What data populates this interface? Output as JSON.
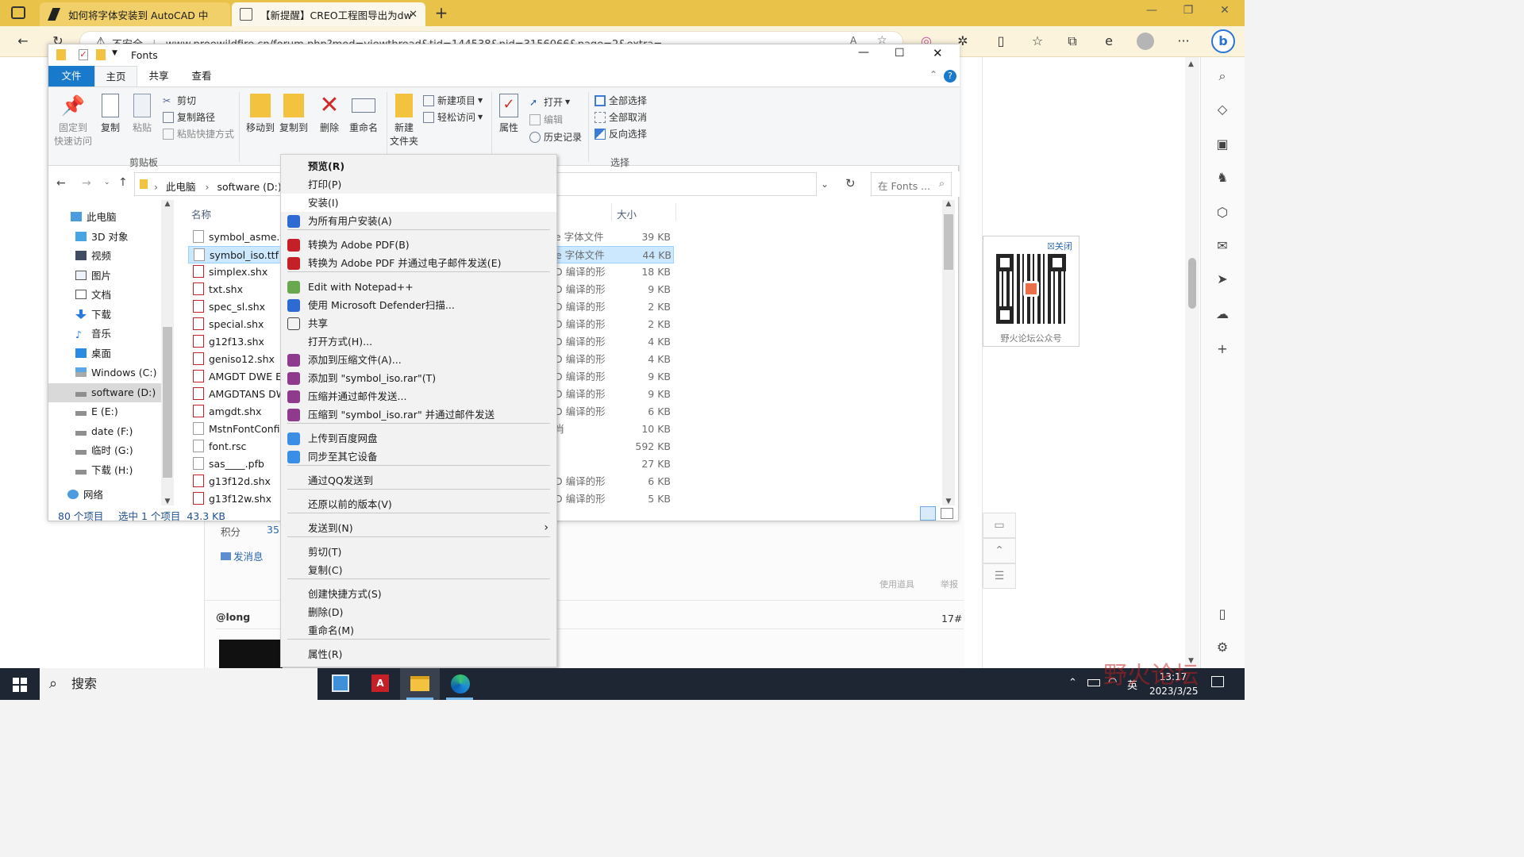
{
  "browser": {
    "tabs": [
      {
        "label": "如何将字体安装到 AutoCAD 中"
      },
      {
        "label": "【新提醒】CREO工程图导出为dwg"
      }
    ],
    "address": {
      "security": "不安全",
      "url": "www.proewildfire.cn/forum.php?mod=viewthread&tid=144538&pid=3156066&page=2&extra="
    }
  },
  "explorer": {
    "title": "Fonts",
    "ribbon_tabs": [
      "文件",
      "主页",
      "共享",
      "查看"
    ],
    "clipboard": {
      "pin": "固定到",
      "pin2": "快速访问",
      "copy": "复制",
      "paste": "粘贴",
      "cut": "剪切",
      "copy_path": "复制路径",
      "paste_shortcut": "粘贴快捷方式",
      "group": "剪贴板"
    },
    "organize": {
      "move_to": "移动到",
      "copy_to": "复制到",
      "delete": "删除",
      "rename": "重命名"
    },
    "new": {
      "new_folder": "新建",
      "new_folder2": "文件夹",
      "new_item": "新建项目",
      "easy_access": "轻松访问"
    },
    "open": {
      "properties": "属性",
      "open": "打开",
      "edit": "编辑",
      "history": "历史记录"
    },
    "select": {
      "select_all": "全部选择",
      "select_none": "全部取消",
      "invert": "反向选择",
      "group": "选择"
    },
    "breadcrumb": [
      "此电脑",
      "software (D:)"
    ],
    "search_placeholder": "在 Fonts ...",
    "nav": [
      {
        "label": "此电脑"
      },
      {
        "label": "3D 对象"
      },
      {
        "label": "视频"
      },
      {
        "label": "图片"
      },
      {
        "label": "文档"
      },
      {
        "label": "下载"
      },
      {
        "label": "音乐"
      },
      {
        "label": "桌面"
      },
      {
        "label": "Windows (C:)"
      },
      {
        "label": "software (D:)"
      },
      {
        "label": "E (E:)"
      },
      {
        "label": "date (F:)"
      },
      {
        "label": "临时 (G:)"
      },
      {
        "label": "下载 (H:)"
      },
      {
        "label": "网络"
      }
    ],
    "columns": {
      "name": "名称",
      "size": "大小"
    },
    "files": [
      {
        "name": "symbol_asme.ttf",
        "type": "e 字体文件",
        "size": "39 KB"
      },
      {
        "name": "symbol_iso.ttf",
        "type": "e 字体文件",
        "size": "44 KB"
      },
      {
        "name": "simplex.shx",
        "type": "D 编译的形",
        "size": "18 KB"
      },
      {
        "name": "txt.shx",
        "type": "D 编译的形",
        "size": "9 KB"
      },
      {
        "name": "spec_sl.shx",
        "type": "D 编译的形",
        "size": "2 KB"
      },
      {
        "name": "special.shx",
        "type": "D 编译的形",
        "size": "2 KB"
      },
      {
        "name": "g12f13.shx",
        "type": "D 编译的形",
        "size": "4 KB"
      },
      {
        "name": "geniso12.shx",
        "type": "D 编译的形",
        "size": "4 KB"
      },
      {
        "name": "AMGDT DWE Ec",
        "type": "D 编译的形",
        "size": "9 KB"
      },
      {
        "name": "AMGDTANS DW",
        "type": "D 编译的形",
        "size": "9 KB"
      },
      {
        "name": "amgdt.shx",
        "type": "D 编译的形",
        "size": "6 KB"
      },
      {
        "name": "MstnFontConfi",
        "type": "肖",
        "size": "10 KB"
      },
      {
        "name": "font.rsc",
        "type": "",
        "size": "592 KB"
      },
      {
        "name": "sas____.pfb",
        "type": "",
        "size": "27 KB"
      },
      {
        "name": "g13f12d.shx",
        "type": "D 编译的形",
        "size": "6 KB"
      },
      {
        "name": "g13f12w.shx",
        "type": "D 编译的形",
        "size": "5 KB"
      }
    ],
    "status": {
      "count": "80 个项目",
      "selected": "选中 1 个项目  43.3 KB"
    }
  },
  "context_menu": [
    {
      "label": "预览(R)"
    },
    {
      "label": "打印(P)"
    },
    {
      "label": "安装(I)"
    },
    {
      "label": "为所有用户安装(A)"
    },
    {
      "label": "转换为 Adobe PDF(B)"
    },
    {
      "label": "转换为 Adobe PDF 并通过电子邮件发送(E)"
    },
    {
      "label": "Edit with Notepad++"
    },
    {
      "label": "使用 Microsoft Defender扫描..."
    },
    {
      "label": "共享"
    },
    {
      "label": "打开方式(H)..."
    },
    {
      "label": "添加到压缩文件(A)..."
    },
    {
      "label": "添加到 \"symbol_iso.rar\"(T)"
    },
    {
      "label": "压缩并通过邮件发送..."
    },
    {
      "label": "压缩到 \"symbol_iso.rar\" 并通过邮件发送"
    },
    {
      "label": "上传到百度网盘"
    },
    {
      "label": "同步至其它设备"
    },
    {
      "label": "通过QQ发送到"
    },
    {
      "label": "还原以前的版本(V)"
    },
    {
      "label": "发送到(N)"
    },
    {
      "label": "剪切(T)"
    },
    {
      "label": "复制(C)"
    },
    {
      "label": "创建快捷方式(S)"
    },
    {
      "label": "删除(D)"
    },
    {
      "label": "重命名(M)"
    },
    {
      "label": "属性(R)"
    }
  ],
  "page": {
    "points_label": "积分",
    "points_value": "35",
    "send_msg": "发消息",
    "tools": "使用道具",
    "report": "举报",
    "user": "@long",
    "floor": "17#",
    "qr_close": "关闭",
    "qr_caption": "野火论坛公众号"
  },
  "taskbar": {
    "search": "搜索",
    "ime": "英",
    "time": "13:17",
    "date": "2023/3/25"
  },
  "watermark": "野火论坛",
  "colors": {
    "accent": "#1979ca",
    "selection": "#cce8ff",
    "taskbar": "#1f2633",
    "tabbar": "#e9c24a"
  }
}
